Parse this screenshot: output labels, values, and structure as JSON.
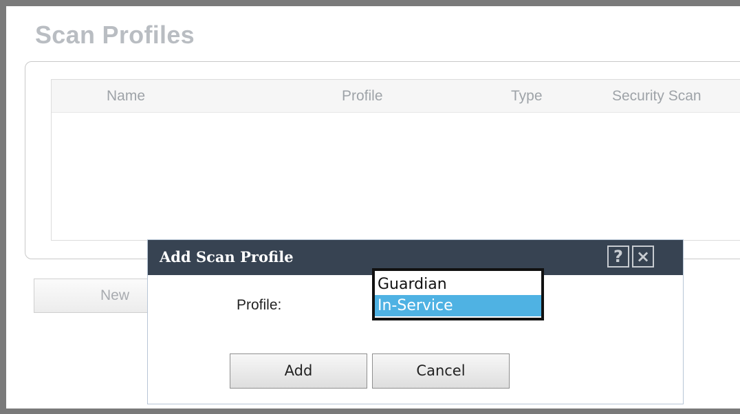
{
  "page": {
    "title": "Scan Profiles"
  },
  "table": {
    "columns": [
      "Name",
      "Profile",
      "Type",
      "Security Scan"
    ],
    "rows": []
  },
  "toolbar": {
    "new_label": "New"
  },
  "dialog": {
    "title": "Add Scan Profile",
    "help_icon": "?",
    "close_icon": "×",
    "profile_label": "Profile:",
    "profile_options": [
      "Guardian",
      "In-Service"
    ],
    "selected_option": "In-Service",
    "add_label": "Add",
    "cancel_label": "Cancel"
  }
}
